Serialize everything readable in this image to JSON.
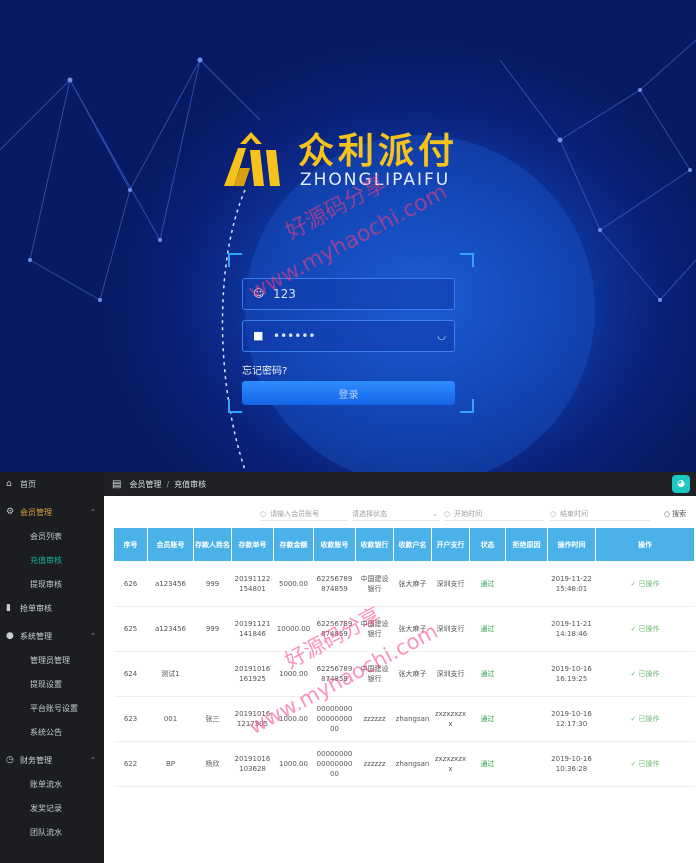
{
  "login": {
    "logo_cn": "众利派付",
    "logo_en": "ZHONGLIPAIFU",
    "username_value": "123",
    "password_value": "••••••",
    "forgot": "忘记密码?",
    "login_button": "登录",
    "watermark_1": "好源码分享",
    "watermark_2": "www.myhaochi.com"
  },
  "sidebar": {
    "items": [
      {
        "label": "首页",
        "icon": "home-icon"
      },
      {
        "label": "会员管理",
        "icon": "gear-icon"
      },
      {
        "label": "会员列表"
      },
      {
        "label": "充值审核"
      },
      {
        "label": "提现审核"
      },
      {
        "label": "抢单审核",
        "icon": "bar-icon"
      },
      {
        "label": "系统管理",
        "icon": "globe-icon"
      },
      {
        "label": "管理员管理"
      },
      {
        "label": "提现设置"
      },
      {
        "label": "平台账号设置"
      },
      {
        "label": "系统公告"
      },
      {
        "label": "财务管理",
        "icon": "clock-icon"
      },
      {
        "label": "账单流水"
      },
      {
        "label": "发奖记录"
      },
      {
        "label": "团队流水"
      }
    ]
  },
  "topbar": {
    "crumb1": "会员管理",
    "sep": "/",
    "crumb2": "充值审核"
  },
  "filter": {
    "account_placeholder": "请输入会员账号",
    "status_placeholder": "请选择状态",
    "start_placeholder": "开始时间",
    "end_placeholder": "结束时间",
    "search": "搜索"
  },
  "table": {
    "headers": [
      "序号",
      "会员账号",
      "存款人姓名",
      "存款单号",
      "存款金额",
      "收款账号",
      "收款银行",
      "收款户名",
      "开户支行",
      "状态",
      "拒绝原因",
      "操作时间",
      "操作"
    ],
    "rows": [
      [
        "626",
        "a123456",
        "999",
        "20191122154801",
        "5000.00",
        "62256789874859",
        "中国建设银行",
        "张大麻子",
        "深圳支行",
        "通过",
        "",
        "2019-11-22 15:48:01",
        "✓ 已操作"
      ],
      [
        "625",
        "a123456",
        "999",
        "20191121141846",
        "10000.00",
        "62256789874859",
        "中国建设银行",
        "张大麻子",
        "深圳支行",
        "通过",
        "",
        "2019-11-21 14:18:46",
        "✓ 已操作"
      ],
      [
        "624",
        "测试1",
        "",
        "20191016161925",
        "1000.00",
        "62256789874859",
        "中国建设银行",
        "张大麻子",
        "深圳支行",
        "通过",
        "",
        "2019-10-16 16:19:25",
        "✓ 已操作"
      ],
      [
        "623",
        "001",
        "张三",
        "201910161217305",
        "1000.00",
        "000000000000000000",
        "zzzzzz",
        "zhangsan",
        "zxzxzxzxx",
        "通过",
        "",
        "2019-10-16 12:17:30",
        "✓ 已操作"
      ],
      [
        "622",
        "BP",
        "杨欣",
        "20191016103628",
        "1000.00",
        "000000000000000000",
        "zzzzzz",
        "zhangsan",
        "zxzxzxzxx",
        "通过",
        "",
        "2019-10-16 10:36:28",
        "✓ 已操作"
      ]
    ]
  },
  "watermark_admin_1": "好源码分享",
  "watermark_admin_2": "www.myhaochi.com"
}
